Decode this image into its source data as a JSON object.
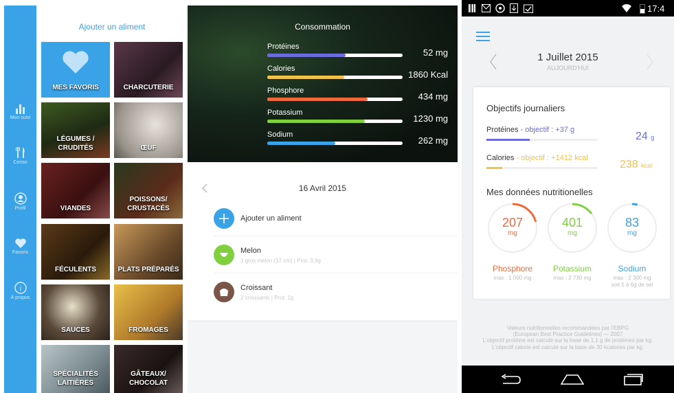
{
  "tablet": {
    "rail": [
      {
        "label": "Mon suivi",
        "icon": "bar-chart-icon"
      },
      {
        "label": "Conso",
        "icon": "fork-knife-icon"
      },
      {
        "label": "Profil",
        "icon": "profile-icon"
      },
      {
        "label": "Favoris",
        "icon": "heart-icon"
      },
      {
        "label": "À propos",
        "icon": "info-icon"
      }
    ],
    "categories_title": "Ajouter un aliment",
    "categories": [
      {
        "line1": "MES FAVORIS",
        "line2": ""
      },
      {
        "line1": "CHARCUTERIE",
        "line2": ""
      },
      {
        "line1": "LÉGUMES /",
        "line2": "CRUDITÉS"
      },
      {
        "line1": "ŒUF",
        "line2": ""
      },
      {
        "line1": "VIANDES",
        "line2": ""
      },
      {
        "line1": "POISSONS/",
        "line2": "CRUSTACÉS"
      },
      {
        "line1": "FÉCULENTS",
        "line2": ""
      },
      {
        "line1": "PLATS PRÉPARÉS",
        "line2": ""
      },
      {
        "line1": "SAUCES",
        "line2": ""
      },
      {
        "line1": "FROMAGES",
        "line2": ""
      },
      {
        "line1": "SPÉCIALITÉS",
        "line2": "LAITIÈRES"
      },
      {
        "line1": "GÂTEAUX/",
        "line2": "CHOCOLAT"
      }
    ],
    "consumption": {
      "title": "Consommation",
      "nutrients": [
        {
          "label": "Protéines",
          "value": "52 mg",
          "fill": 0.58,
          "color": "#6b6bde"
        },
        {
          "label": "Calories",
          "value": "1860 Kcal",
          "fill": 0.57,
          "color": "#f1c24a"
        },
        {
          "label": "Phosphore",
          "value": "434 mg",
          "fill": 0.74,
          "color": "#ee6a3c"
        },
        {
          "label": "Potassium",
          "value": "1230 mg",
          "fill": 0.72,
          "color": "#7fcf3e"
        },
        {
          "label": "Sodium",
          "value": "262 mg",
          "fill": 0.5,
          "color": "#3aa2e6"
        }
      ]
    },
    "day": {
      "date": "16 Avril 2015",
      "add_label": "Ajouter un aliment",
      "foods": [
        {
          "name": "Melon",
          "detail": "1 gros melon (17 cm) | Prot. 3,9g",
          "icon_color": "#7fcf3e"
        },
        {
          "name": "Croissant",
          "detail": "2 croissants | Prot. 1g",
          "icon_color": "#7a5548"
        }
      ]
    }
  },
  "phone": {
    "status_time": "17:4",
    "date": "1 Juillet 2015",
    "date_sub": "AUJOURD'HUI",
    "objectives_title": "Objectifs journaliers",
    "objectives": [
      {
        "label": "Protéines",
        "goal": " - objectif : +37 g",
        "value": "24",
        "unit": "g",
        "fill": 0.39,
        "color": "#6b6bde"
      },
      {
        "label": "Calories",
        "goal": " - objectif : +1412 kcal",
        "value": "238",
        "unit": "kcal",
        "fill": 0.14,
        "color": "#f1c24a"
      }
    ],
    "data_title": "Mes données nutritionelles",
    "rings": [
      {
        "value": "207",
        "unit": "mg",
        "name": "Phosphore",
        "max": "max : 1 000 mg",
        "max2": "",
        "fill": 0.207,
        "color": "#ee6a3c"
      },
      {
        "value": "401",
        "unit": "mg",
        "name": "Potassium",
        "max": "max : 2 730 mg",
        "max2": "",
        "fill": 0.147,
        "color": "#7fcf3e"
      },
      {
        "value": "83",
        "unit": "mg",
        "name": "Sodium",
        "max": "max : 2 300 mg",
        "max2": "soit 5 à 6g de sel",
        "fill": 0.036,
        "color": "#3aa2e6"
      }
    ],
    "footer": [
      "Valeurs nutritionnelles recommandées par l'EBPG",
      "(European Best Practice Guidelines) — 2007",
      "L'objectif protéine est calculé sur la base de 1,1 g de protéines par kg.",
      "L'objectif calorie est calculé sur la base de 30 kcalories par kg."
    ]
  }
}
